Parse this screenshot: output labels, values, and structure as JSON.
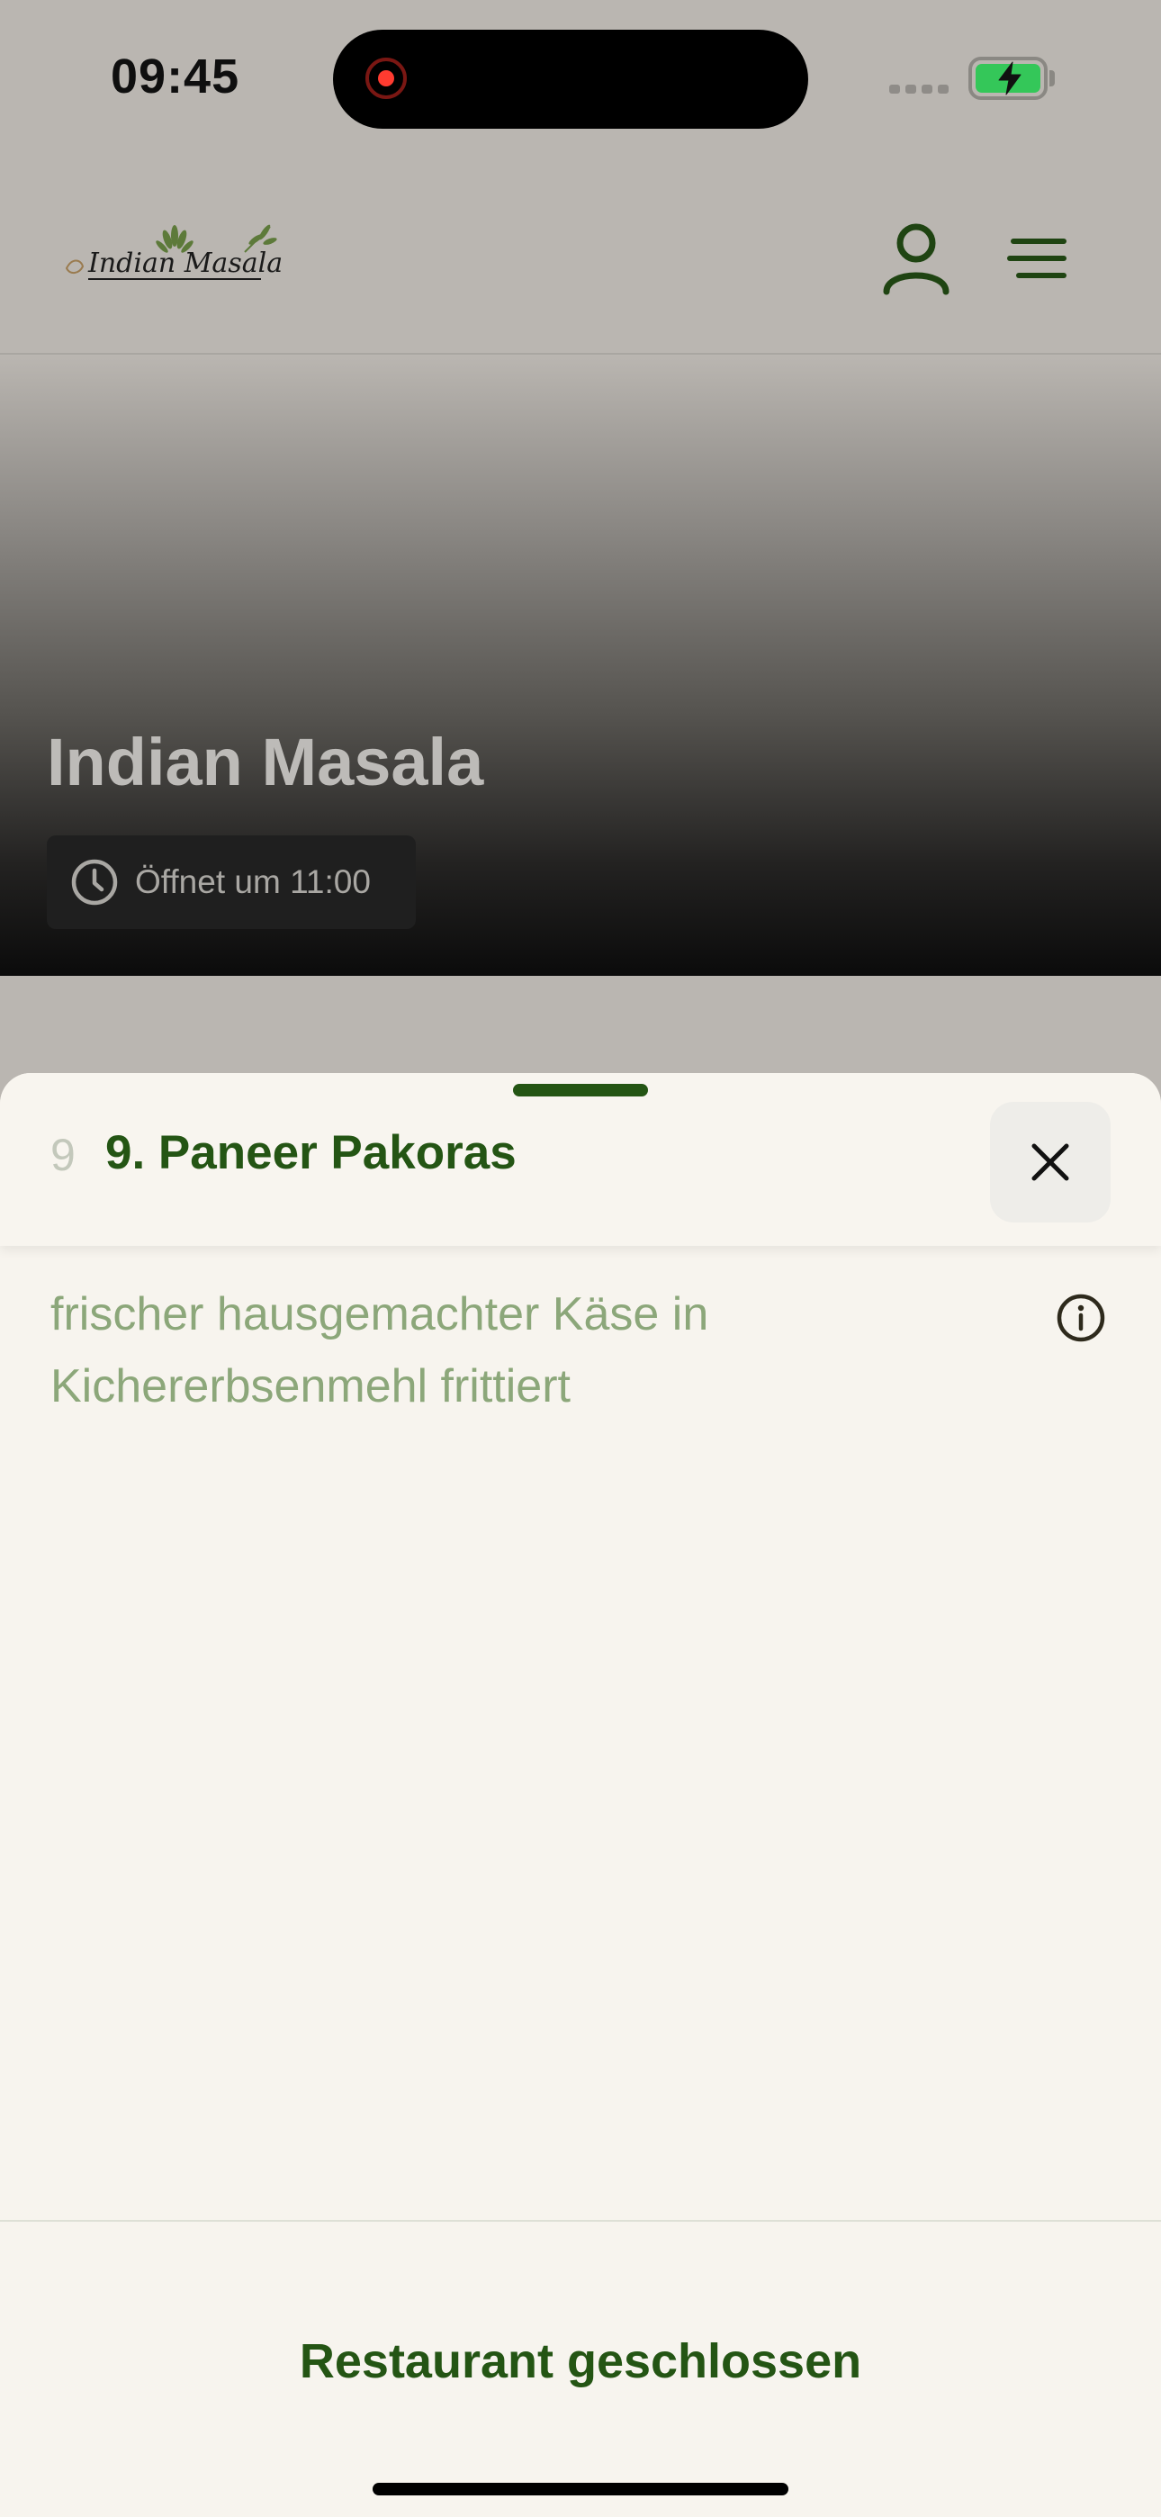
{
  "status_bar": {
    "time": "09:45",
    "recording_icon": "screen-recording-indicator",
    "battery_icon": "battery-charging-icon",
    "battery_color": "#34c759"
  },
  "header": {
    "logo_text": "Indian Masala",
    "user_icon": "user-icon",
    "menu_icon": "hamburger-menu-icon"
  },
  "hero": {
    "title": "Indian Masala",
    "hours_icon": "clock-icon",
    "hours_text": "Öffnet um 11:00"
  },
  "item_sheet": {
    "number": "9",
    "title": "9. Paneer Pakoras",
    "description": "frischer hausgemachter Käse in Kichererbsenmehl frittiert",
    "close_icon": "close-icon",
    "info_icon": "info-icon",
    "footer_status": "Restaurant geschlossen"
  },
  "colors": {
    "brand_green": "#245514",
    "description_green": "#8ca77a",
    "sheet_background": "#f7f4ee",
    "page_background": "#bab6b1"
  }
}
